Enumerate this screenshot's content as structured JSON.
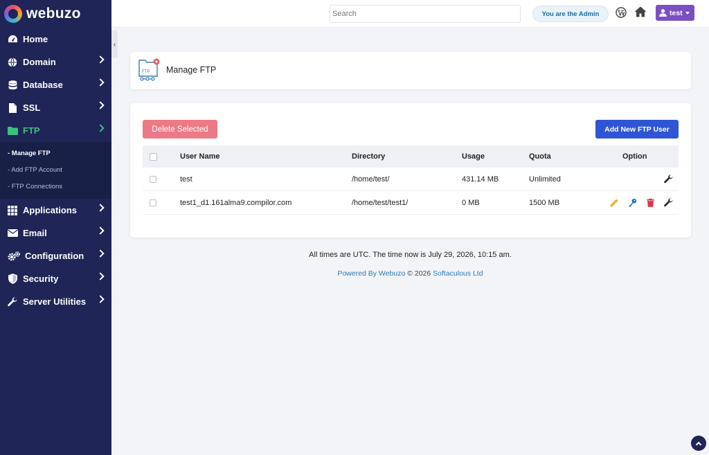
{
  "brand": {
    "name": "webuzo"
  },
  "sidebar": {
    "items": [
      {
        "label": "Home",
        "icon": "tachometer-icon"
      },
      {
        "label": "Domain",
        "icon": "globe-icon"
      },
      {
        "label": "Database",
        "icon": "database-icon"
      },
      {
        "label": "SSL",
        "icon": "file-icon"
      },
      {
        "label": "FTP",
        "icon": "folder-icon",
        "active": true
      },
      {
        "label": "Applications",
        "icon": "grid-icon"
      },
      {
        "label": "Email",
        "icon": "envelope-icon"
      },
      {
        "label": "Configuration",
        "icon": "cogs-icon"
      },
      {
        "label": "Security",
        "icon": "shield-icon"
      },
      {
        "label": "Server Utilities",
        "icon": "wrench-icon"
      }
    ],
    "ftp_submenu": [
      {
        "label": "- Manage FTP",
        "current": true
      },
      {
        "label": "- Add FTP Account"
      },
      {
        "label": "- FTP Connections"
      }
    ]
  },
  "topbar": {
    "search_placeholder": "Search",
    "admin_badge": "You are the Admin",
    "user_label": "test"
  },
  "page": {
    "title": "Manage FTP",
    "delete_label": "Delete Selected",
    "add_label": "Add New FTP User"
  },
  "table": {
    "headers": {
      "user": "User Name",
      "dir": "Directory",
      "usage": "Usage",
      "quota": "Quota",
      "option": "Option"
    },
    "rows": [
      {
        "user": "test",
        "dir": "/home/test/",
        "usage": "431.14 MB",
        "quota": "Unlimited",
        "options": [
          "wrench-icon"
        ]
      },
      {
        "user": "test1_d1.161alma9.compilor.com",
        "dir": "/home/test/test1/",
        "usage": "0 MB",
        "quota": "1500 MB",
        "options": [
          "pencil-icon",
          "key-icon",
          "trash-icon",
          "wrench-icon"
        ]
      }
    ]
  },
  "footer": {
    "time_text": "All times are UTC. The time now is July 29, 2026, 10:15 am.",
    "powered_prefix": "Powered By Webuzo",
    "powered_mid": " © 2026 ",
    "powered_company": "Softaculous Ltd"
  },
  "colors": {
    "sidebar_bg": "#1f2556",
    "active_green": "#3dbf7e",
    "delete_btn": "#ec7a86",
    "add_btn": "#2e55d3",
    "user_btn": "#7b4fc3"
  }
}
